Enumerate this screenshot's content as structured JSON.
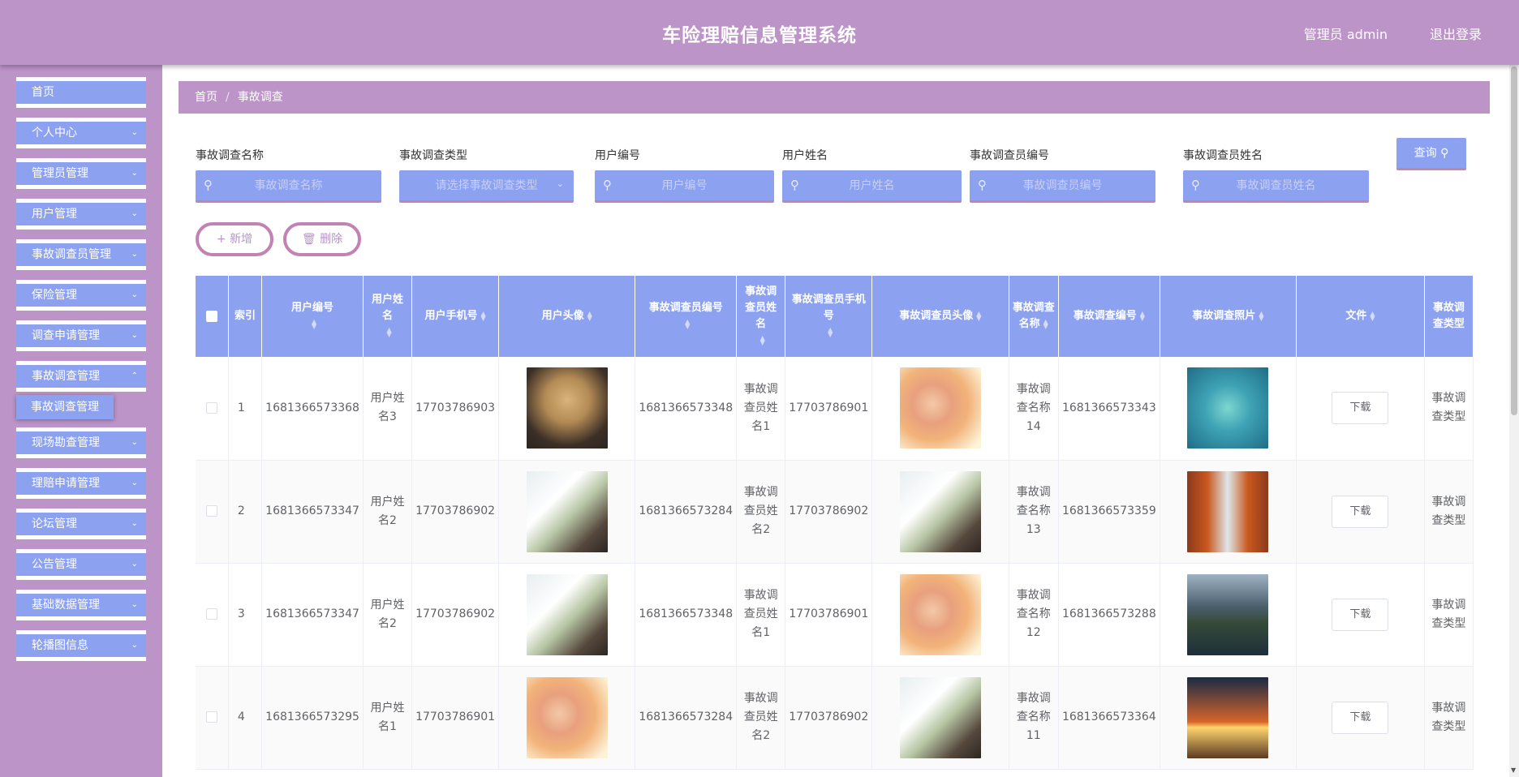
{
  "header": {
    "title": "车险理赔信息管理系统",
    "user": "管理员 admin",
    "logout": "退出登录"
  },
  "sidebar": {
    "items": [
      {
        "label": "首页",
        "expandable": false
      },
      {
        "label": "个人中心",
        "expandable": true
      },
      {
        "label": "管理员管理",
        "expandable": true
      },
      {
        "label": "用户管理",
        "expandable": true
      },
      {
        "label": "事故调查员管理",
        "expandable": true
      },
      {
        "label": "保险管理",
        "expandable": true
      },
      {
        "label": "调查申请管理",
        "expandable": true
      },
      {
        "label": "事故调查管理",
        "expandable": true
      },
      {
        "label": "现场勘查管理",
        "expandable": true
      },
      {
        "label": "理赔申请管理",
        "expandable": true
      },
      {
        "label": "论坛管理",
        "expandable": true
      },
      {
        "label": "公告管理",
        "expandable": true
      },
      {
        "label": "基础数据管理",
        "expandable": true
      },
      {
        "label": "轮播图信息",
        "expandable": true
      }
    ],
    "active_submenu": "事故调查管理"
  },
  "breadcrumb": {
    "home": "首页",
    "separator": "/",
    "current": "事故调查"
  },
  "search": {
    "fields": [
      {
        "label": "事故调查名称",
        "placeholder": "事故调查名称",
        "type": "text"
      },
      {
        "label": "事故调查类型",
        "placeholder": "请选择事故调查类型",
        "type": "select"
      },
      {
        "label": "用户编号",
        "placeholder": "用户编号",
        "type": "text"
      },
      {
        "label": "用户姓名",
        "placeholder": "用户姓名",
        "type": "text"
      },
      {
        "label": "事故调查员编号",
        "placeholder": "事故调查员编号",
        "type": "text"
      },
      {
        "label": "事故调查员姓名",
        "placeholder": "事故调查员姓名",
        "type": "text"
      }
    ],
    "query_label": "查询"
  },
  "actions": {
    "add_label": "新增",
    "delete_label": "删除"
  },
  "table": {
    "columns": [
      "索引",
      "用户编号",
      "用户姓名",
      "用户手机号",
      "用户头像",
      "事故调查员编号",
      "事故调查员姓名",
      "事故调查员手机号",
      "事故调查员头像",
      "事故调查名称",
      "事故调查编号",
      "事故调查照片",
      "文件",
      "事故调查类型"
    ],
    "rows": [
      {
        "index": "1",
        "user_no": "1681366573368",
        "user_name": "用户姓名3",
        "user_phone": "17703786903",
        "user_avatar": "puppy",
        "inv_no": "1681366573348",
        "inv_name": "事故调查员姓名1",
        "inv_phone": "17703786901",
        "inv_avatar": "girl",
        "case_name": "事故调查名称14",
        "case_no": "1681366573343",
        "photo": "heart-island",
        "download": "下载",
        "type": "事故调查类型"
      },
      {
        "index": "2",
        "user_no": "1681366573347",
        "user_name": "用户姓名2",
        "user_phone": "17703786902",
        "user_avatar": "boy",
        "inv_no": "1681366573284",
        "inv_name": "事故调查员姓名2",
        "inv_phone": "17703786902",
        "inv_avatar": "boy",
        "case_name": "事故调查名称13",
        "case_no": "1681366573359",
        "photo": "corridor",
        "download": "下载",
        "type": "事故调查类型"
      },
      {
        "index": "3",
        "user_no": "1681366573347",
        "user_name": "用户姓名2",
        "user_phone": "17703786902",
        "user_avatar": "boy",
        "inv_no": "1681366573348",
        "inv_name": "事故调查员姓名1",
        "inv_phone": "17703786901",
        "inv_avatar": "girl",
        "case_name": "事故调查名称12",
        "case_no": "1681366573288",
        "photo": "lake",
        "download": "下载",
        "type": "事故调查类型"
      },
      {
        "index": "4",
        "user_no": "1681366573295",
        "user_name": "用户姓名1",
        "user_phone": "17703786901",
        "user_avatar": "girl",
        "inv_no": "1681366573284",
        "inv_name": "事故调查员姓名2",
        "inv_phone": "17703786902",
        "inv_avatar": "boy",
        "case_name": "事故调查名称11",
        "case_no": "1681366573364",
        "photo": "sunset",
        "download": "下载",
        "type": "事故调查类型"
      }
    ]
  },
  "colors": {
    "primary": "#bc94c8",
    "accent": "#8ca1ef",
    "border": "#c282b4"
  },
  "icons": {
    "search": "search-icon",
    "plus": "plus-icon",
    "trash": "trash-icon",
    "chevron": "chevron-down-icon",
    "sort": "sort-icon"
  }
}
